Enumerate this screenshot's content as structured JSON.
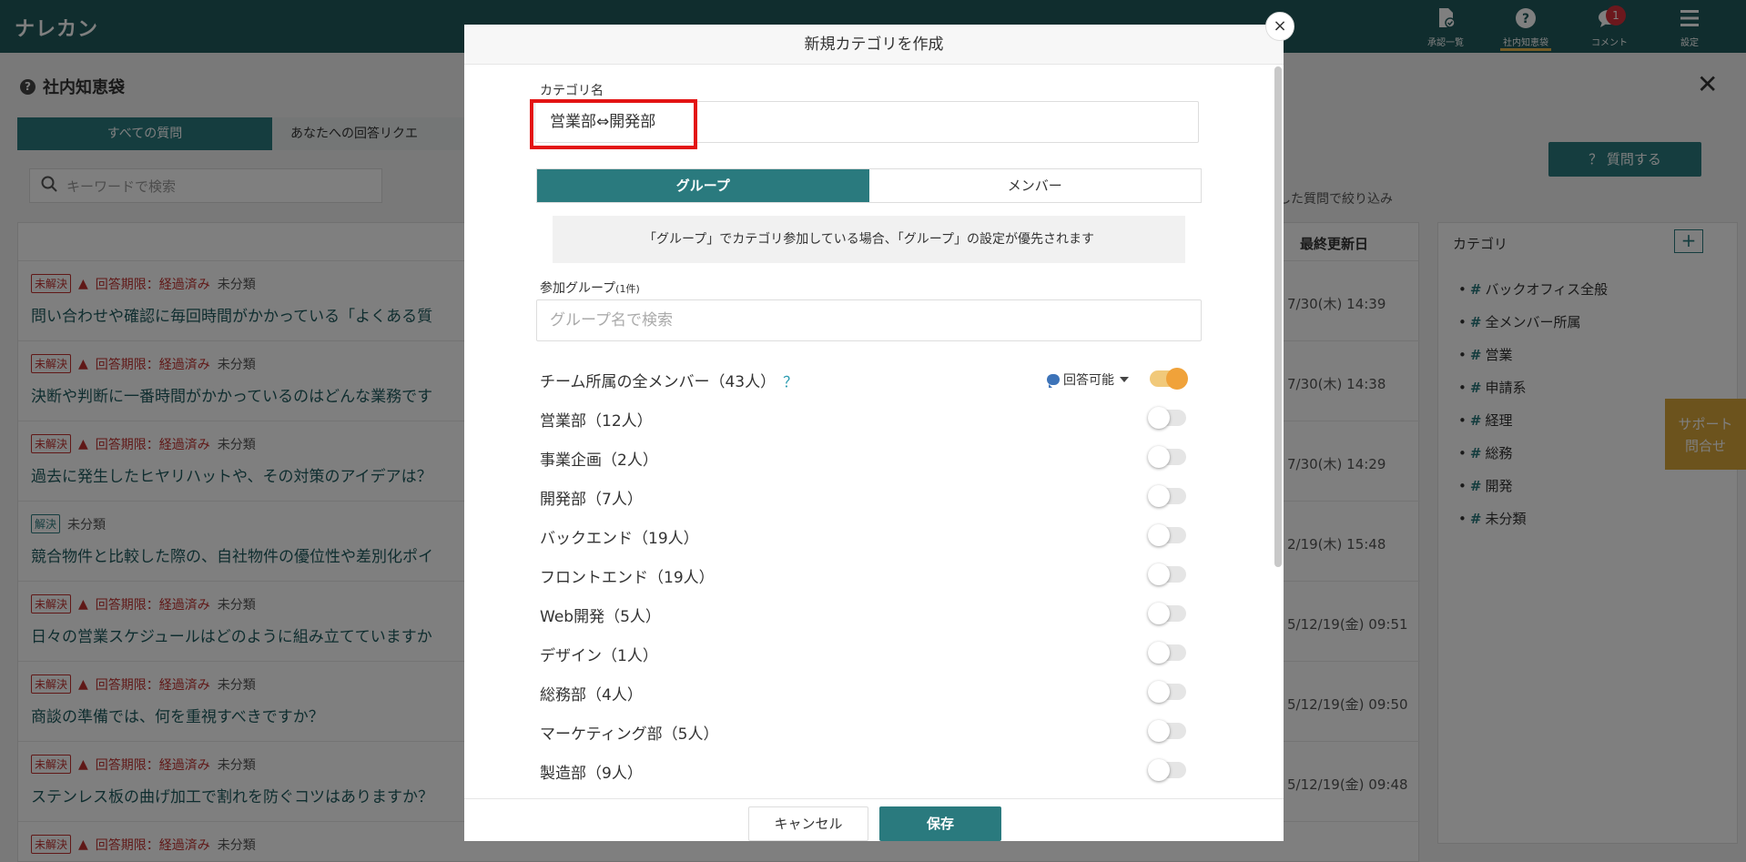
{
  "app": {
    "brand": "ナレカン"
  },
  "nav": [
    {
      "label": "承認一覧",
      "icon": "approval-doc-icon"
    },
    {
      "label": "社内知恵袋",
      "icon": "question-circle-icon",
      "active": true
    },
    {
      "label": "コメント",
      "icon": "comment-icon",
      "badge": "1"
    },
    {
      "label": "設定",
      "icon": "menu-icon"
    }
  ],
  "page": {
    "title": "社内知恵袋",
    "tabs": [
      "すべての質問",
      "あなたへの回答リクエ"
    ],
    "search_placeholder": "キーワードで検索",
    "ask_button": "？ 質問する",
    "filter_text": "した質問で絞り込み",
    "last_updated_header": "最終更新日"
  },
  "questions": [
    {
      "status": "未解決",
      "deadline": "回答期限：経過済み",
      "category": "未分類",
      "title": "問い合わせや確認に毎回時間がかかっている「よくある質",
      "date": "7/30(木) 14:39"
    },
    {
      "status": "未解決",
      "deadline": "回答期限：経過済み",
      "category": "未分類",
      "title": "決断や判断に一番時間がかかっているのはどんな業務です",
      "date": "7/30(木) 14:38"
    },
    {
      "status": "未解決",
      "deadline": "回答期限：経過済み",
      "category": "未分類",
      "title": "過去に発生したヒヤリハットや、その対策のアイデアは？",
      "date": "7/30(木) 14:29"
    },
    {
      "status": "解決",
      "deadline": "",
      "category": "未分類",
      "title": "競合物件と比較した際の、自社物件の優位性や差別化ポイ",
      "date": "2/19(木) 15:48"
    },
    {
      "status": "未解決",
      "deadline": "回答期限：経過済み",
      "category": "未分類",
      "title": "日々の営業スケジュールはどのように組み立てていますか",
      "date": "5/12/19(金) 09:51"
    },
    {
      "status": "未解決",
      "deadline": "回答期限：経過済み",
      "category": "未分類",
      "title": "商談の準備では、何を重視すべきですか？",
      "date": "5/12/19(金) 09:50"
    },
    {
      "status": "未解決",
      "deadline": "回答期限：経過済み",
      "category": "未分類",
      "title": "ステンレス板の曲げ加工で割れを防ぐコツはありますか？",
      "date": "5/12/19(金) 09:48"
    },
    {
      "status": "未解決",
      "deadline": "回答期限：経過済み",
      "category": "未分類",
      "title": "",
      "date": ""
    }
  ],
  "categories": {
    "title": "カテゴリ",
    "add": "+",
    "items": [
      "バックオフィス全般",
      "全メンバー所属",
      "営業",
      "申請系",
      "経理",
      "総務",
      "開発",
      "未分類"
    ]
  },
  "support": {
    "line1": "サポート",
    "line2": "問合せ"
  },
  "modal": {
    "title": "新規カテゴリを作成",
    "close": "×",
    "name_label": "カテゴリ名",
    "name_value": "営業部⇔開発部",
    "seg_group": "グループ",
    "seg_member": "メンバー",
    "notice": "「グループ」でカテゴリ参加している場合、「グループ」の設定が優先されます",
    "group_label": "参加グループ",
    "group_count": "(1件)",
    "group_search_placeholder": "グループ名で検索",
    "answerable": "回答可能",
    "help": "？",
    "groups": [
      {
        "name": "チーム所属の全メンバー（43人）",
        "on": true,
        "help": true
      },
      {
        "name": "営業部（12人）",
        "on": false
      },
      {
        "name": "事業企画（2人）",
        "on": false
      },
      {
        "name": "開発部（7人）",
        "on": false
      },
      {
        "name": "バックエンド（19人）",
        "on": false
      },
      {
        "name": "フロントエンド（19人）",
        "on": false
      },
      {
        "name": "Web開発（5人）",
        "on": false
      },
      {
        "name": "デザイン（1人）",
        "on": false
      },
      {
        "name": "総務部（4人）",
        "on": false
      },
      {
        "name": "マーケティング部（5人）",
        "on": false
      },
      {
        "name": "製造部（9人）",
        "on": false
      }
    ],
    "cancel": "キャンセル",
    "save": "保存"
  },
  "colors": {
    "header": "#205a5c",
    "accent": "#2a7a7e",
    "warning": "#c0312f",
    "toggle_on": "#f0a23a",
    "highlight": "#e31414"
  }
}
